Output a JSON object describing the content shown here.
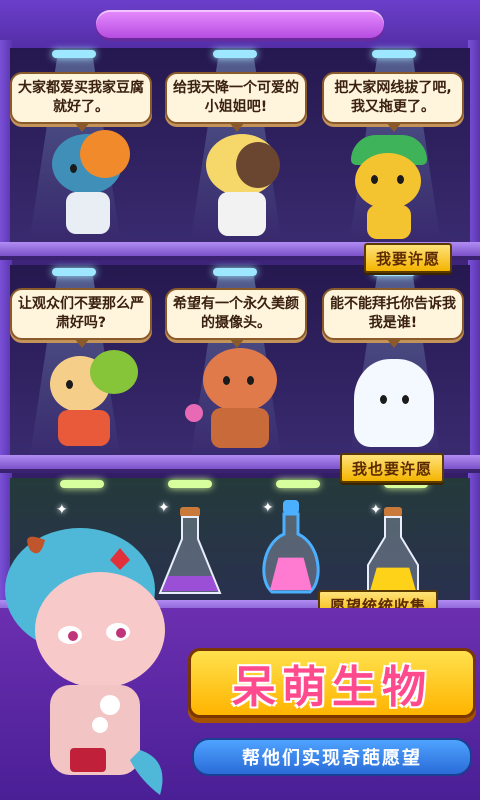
{
  "shelves": [
    {
      "bubbles": [
        "大家都爱买我家豆腐就好了。",
        "给我天降一个可爱的小姐姐吧!",
        "把大家网线拔了吧,我又拖更了。"
      ],
      "button": "我要许愿"
    },
    {
      "bubbles": [
        "让观众们不要那么严肃好吗?",
        "希望有一个永久美颜的摄像头。",
        "能不能拜托你告诉我我是谁!"
      ],
      "button": "我也要许愿"
    },
    {
      "button": "愿望统统收集"
    }
  ],
  "title": "呆萌生物",
  "subtitle": "帮他们实现奇葩愿望",
  "colors": {
    "title_text": "#ff4a8d",
    "title_bg": "#ffc21a",
    "button_bg": "#f4b400",
    "subtitle_bg": "#2a6bd8"
  },
  "potions": [
    {
      "liquid_color": "#9a4fd6",
      "fill": 0.3
    },
    {
      "liquid_color": "#ff7ad1",
      "fill": 0.6
    },
    {
      "liquid_color": "#ffd21a",
      "fill": 0.45
    }
  ]
}
